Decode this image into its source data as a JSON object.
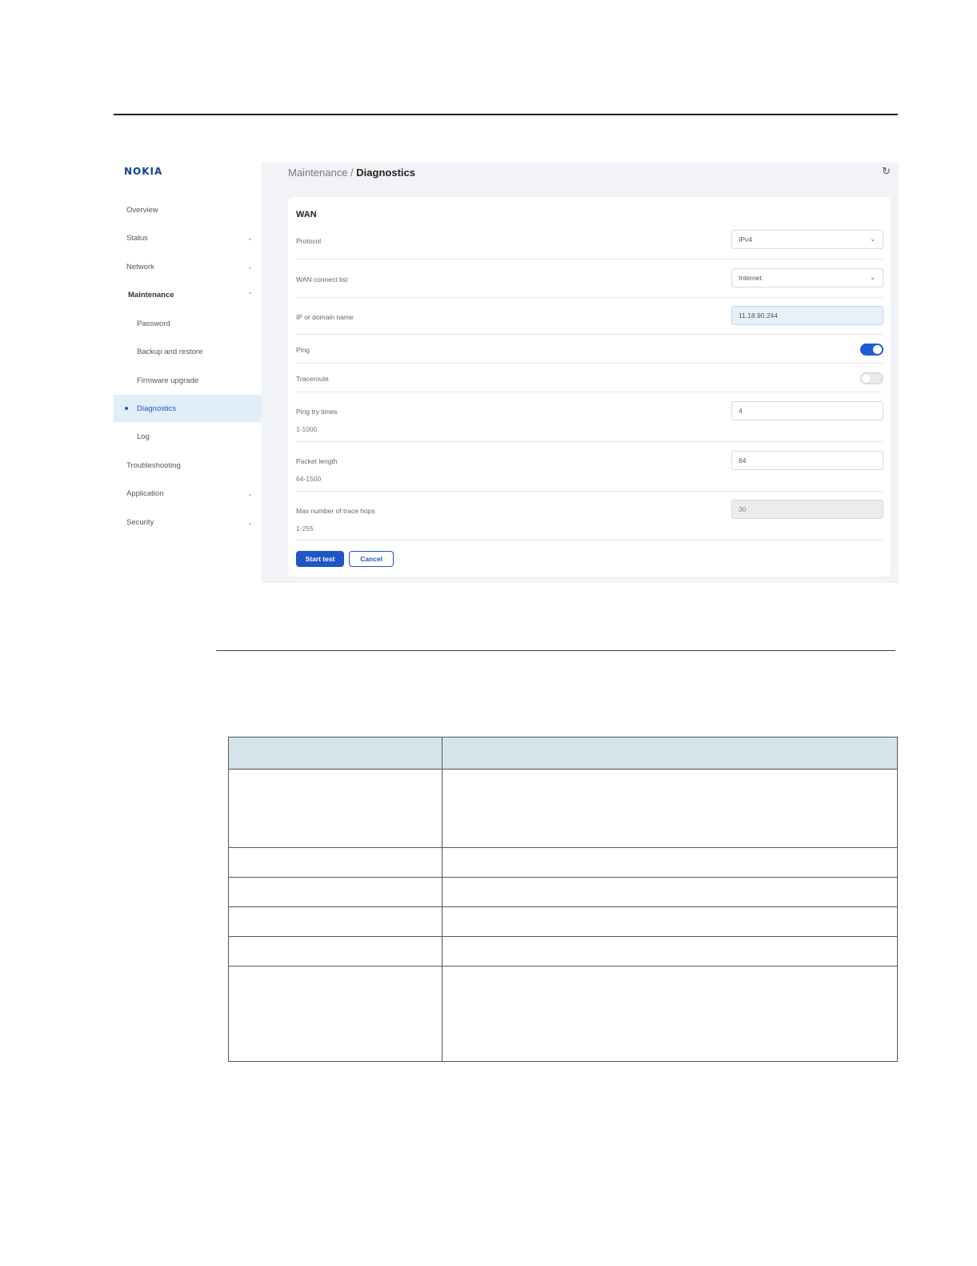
{
  "brand": {
    "logo": "NOKIA"
  },
  "sidebar": {
    "items": [
      {
        "label": "Overview",
        "chevron": ""
      },
      {
        "label": "Status",
        "chevron": "⌄"
      },
      {
        "label": "Network",
        "chevron": "⌄"
      },
      {
        "label": "Maintenance",
        "chevron": "⌃"
      },
      {
        "label": "Password",
        "chevron": ""
      },
      {
        "label": "Backup and restore",
        "chevron": ""
      },
      {
        "label": "Firmware upgrade",
        "chevron": ""
      },
      {
        "label": "Diagnostics",
        "chevron": ""
      },
      {
        "label": "Log",
        "chevron": ""
      },
      {
        "label": "Troubleshooting",
        "chevron": ""
      },
      {
        "label": "Application",
        "chevron": "⌄"
      },
      {
        "label": "Security",
        "chevron": "⌄"
      }
    ]
  },
  "breadcrumb": {
    "parent": "Maintenance /",
    "current": "Diagnostics"
  },
  "form": {
    "title": "WAN",
    "protocol": {
      "label": "Protocol",
      "value": "IPv4"
    },
    "wan_connect_list": {
      "label": "WAN connect list",
      "value": "Internet"
    },
    "ip_or_domain": {
      "label": "IP or domain name",
      "value": "11.18.90.244"
    },
    "ping": {
      "label": "Ping",
      "enabled": true
    },
    "traceroute": {
      "label": "Traceroute",
      "enabled": false
    },
    "ping_try_times": {
      "label": "Ping try times",
      "range": "1-1000",
      "value": "4"
    },
    "packet_length": {
      "label": "Packet length",
      "range": "64-1500",
      "value": "64"
    },
    "max_trace_hops": {
      "label": "Max number of trace hops",
      "range": "1-255",
      "value": "30"
    },
    "start_label": "Start test",
    "cancel_label": "Cancel"
  },
  "colors": {
    "accent": "#1f55c4",
    "brand": "#124191",
    "table_header": "#d4e4eb"
  },
  "icons": {
    "refresh": "refresh-icon",
    "chevron": "chevron-down-icon"
  }
}
